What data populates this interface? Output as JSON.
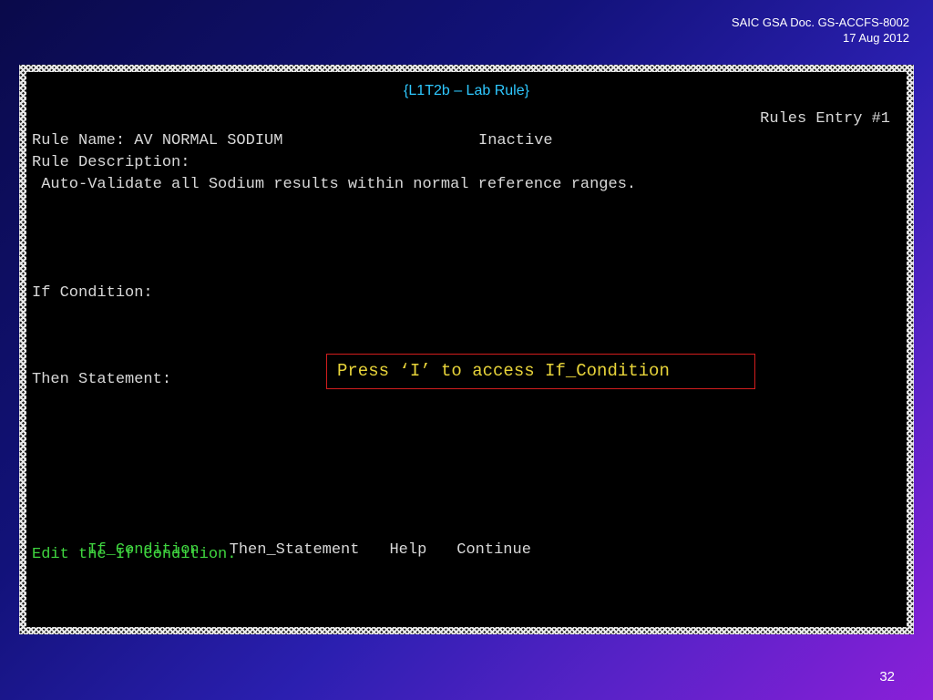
{
  "slide": {
    "doc_ref": "SAIC GSA Doc. GS-ACCFS-8002",
    "doc_date": "17 Aug 2012",
    "page_number": "32"
  },
  "terminal": {
    "title": "{L1T2b – Lab Rule}",
    "entry_label": "Rules Entry #1",
    "rule_name_label": "Rule Name: AV NORMAL SODIUM",
    "rule_status": "Inactive",
    "rule_description_label": "Rule Description:",
    "rule_description": " Auto-Validate all Sodium results within normal reference ranges.",
    "if_condition_label": "If Condition:",
    "then_statement_label": "Then Statement:",
    "menu": {
      "items": [
        "If_Condition",
        "Then_Statement",
        "Help",
        "Continue"
      ]
    },
    "prompt": "Edit the If Condition."
  },
  "callout": {
    "text": "Press ‘I’ to access If_Condition"
  },
  "colors": {
    "title": "#2ec8ff",
    "highlight_green": "#3fd43f",
    "callout_text": "#e8d43a",
    "callout_border": "#d21e1e"
  }
}
